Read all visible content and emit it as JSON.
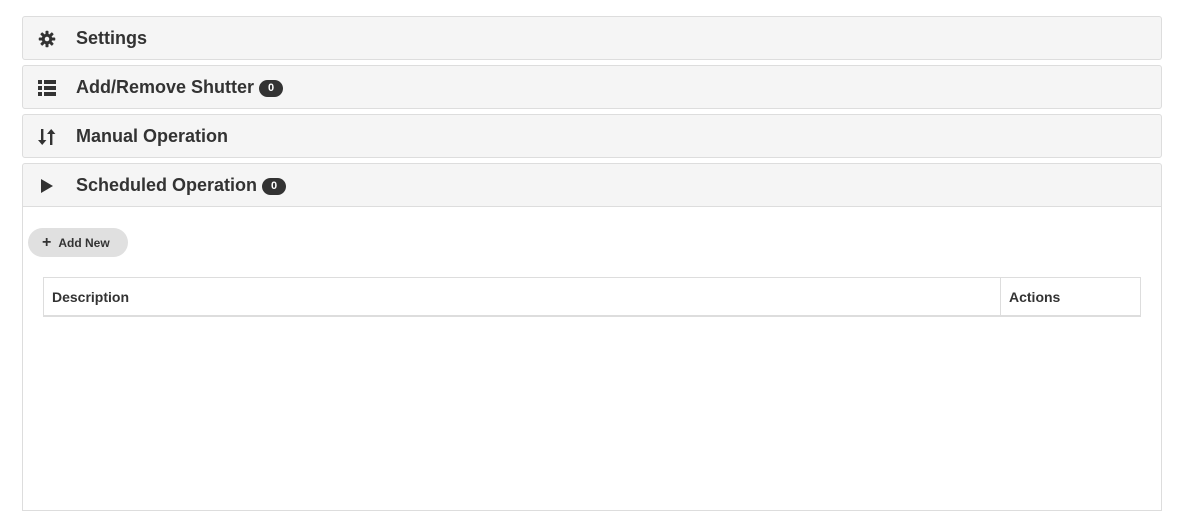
{
  "panels": [
    {
      "title": "Settings",
      "icon": "gear-icon",
      "badge": null
    },
    {
      "title": "Add/Remove Shutter",
      "icon": "list-icon",
      "badge": "0"
    },
    {
      "title": "Manual Operation",
      "icon": "sort-arrows-icon",
      "badge": null
    },
    {
      "title": "Scheduled Operation",
      "icon": "play-icon",
      "badge": "0",
      "open": true
    }
  ],
  "scheduled": {
    "add_new_label": "Add New",
    "table": {
      "columns": [
        "Description",
        "Actions"
      ],
      "rows": []
    }
  }
}
